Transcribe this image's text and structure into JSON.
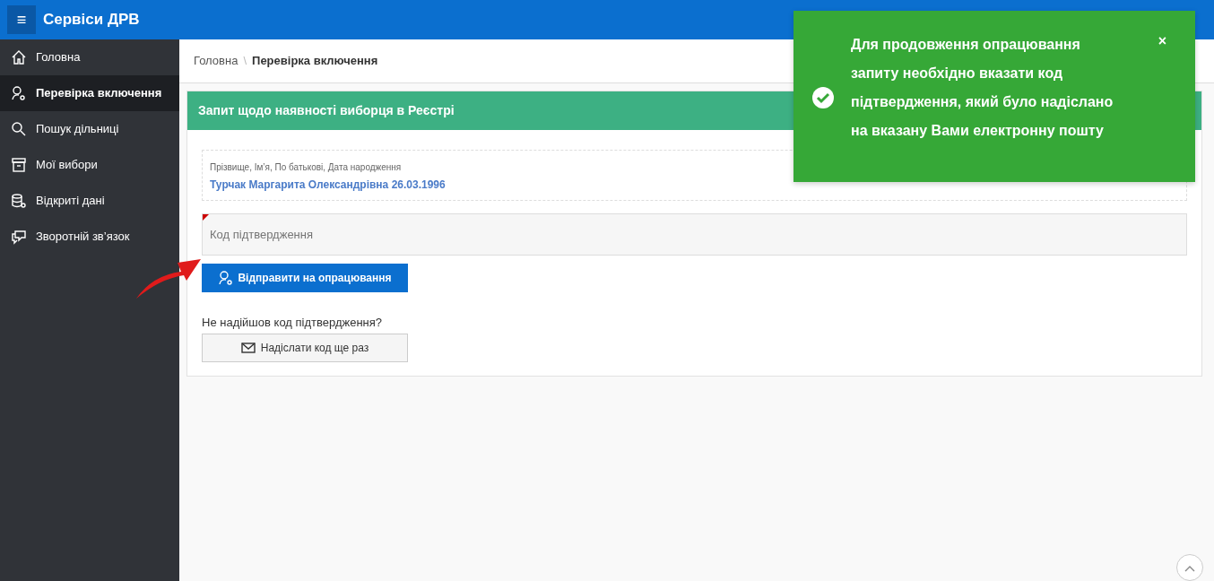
{
  "header": {
    "menu_glyph": "≡",
    "title": "Сервіси ДРВ"
  },
  "sidebar": {
    "items": [
      {
        "label": "Головна",
        "kind": "home",
        "selected": false
      },
      {
        "label": "Перевірка включення",
        "kind": "check",
        "selected": true
      },
      {
        "label": "Пошук дільниці",
        "kind": "search",
        "selected": false
      },
      {
        "label": "Мої вибори",
        "kind": "archive",
        "selected": false
      },
      {
        "label": "Відкриті дані",
        "kind": "data",
        "selected": false
      },
      {
        "label": "Зворотній зв’язок",
        "kind": "chat",
        "selected": false
      }
    ]
  },
  "breadcrumb": [
    {
      "label": "Головна",
      "current": false
    },
    {
      "label": "Перевірка включення",
      "current": true
    }
  ],
  "breadcrumb_separator": "\\",
  "card": {
    "title": "Запит щодо наявності виборця в Реєстрі",
    "person": {
      "label": "Прізвище, Ім’я, По батькові, Дата народження",
      "value": "Турчак Маргарита Олександрівна 26.03.1996"
    },
    "code_field": {
      "placeholder": "Код підтвердження",
      "required": true
    },
    "submit_button": "Відправити на опрацювання",
    "resend_prompt": "Не надійшов код підтвердження?",
    "resend_button": "Надіслати код ще раз"
  },
  "toast": {
    "message": "Для продовження опрацювання запиту необхідно вказати код підтвердження, який було надіслано на вказану Вами електронну пошту",
    "close_glyph": "×"
  }
}
